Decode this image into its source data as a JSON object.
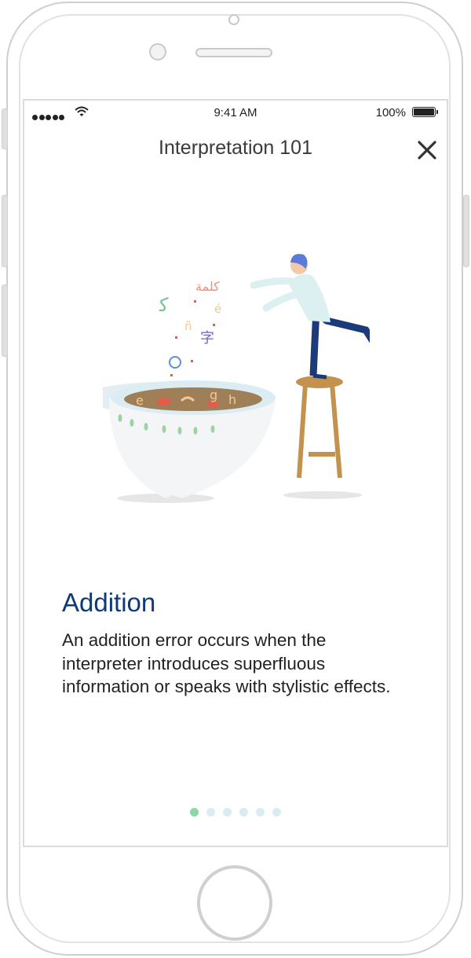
{
  "status_bar": {
    "time": "9:41 AM",
    "battery": "100%"
  },
  "header": {
    "title": "Interpretation 101"
  },
  "content": {
    "heading": "Addition",
    "description": "An addition error occurs when the interpreter introduces superfluous information or speaks with stylistic effects."
  },
  "illustration": {
    "glyphs": [
      "كلمة",
      "字",
      "ñ",
      "é",
      "g",
      "h",
      "e"
    ]
  },
  "pagination": {
    "count": 6,
    "active_index": 0
  },
  "colors": {
    "heading": "#0f3a7a",
    "dot_active": "#8fd6a9",
    "dot_inactive": "#d9ecf2"
  }
}
